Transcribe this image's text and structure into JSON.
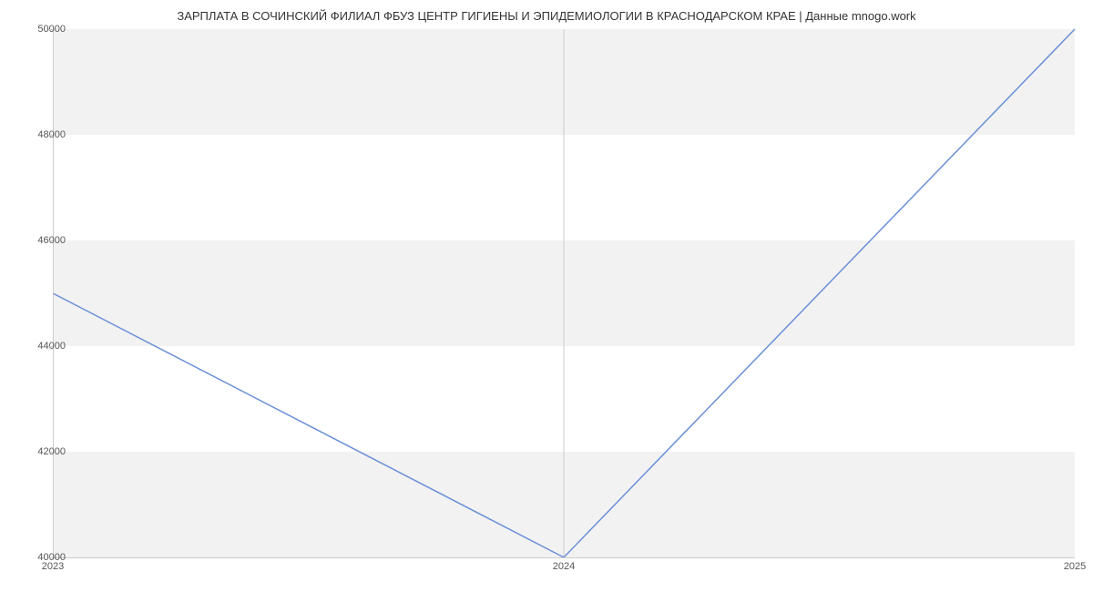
{
  "chart_data": {
    "type": "line",
    "title": "ЗАРПЛАТА В СОЧИНСКИЙ ФИЛИАЛ ФБУЗ ЦЕНТР ГИГИЕНЫ И ЭПИДЕМИОЛОГИИ В КРАСНОДАРСКОМ КРАЕ | Данные mnogo.work",
    "x": [
      2023,
      2024,
      2025
    ],
    "values": [
      45000,
      40000,
      50000
    ],
    "xlabel": "",
    "ylabel": "",
    "ylim": [
      40000,
      50000
    ],
    "xlim": [
      2023,
      2025
    ],
    "y_ticks": [
      40000,
      42000,
      44000,
      46000,
      48000,
      50000
    ],
    "x_ticks": [
      2023,
      2024,
      2025
    ],
    "line_color": "#6a8fd8",
    "band_color": "#f2f2f2"
  }
}
